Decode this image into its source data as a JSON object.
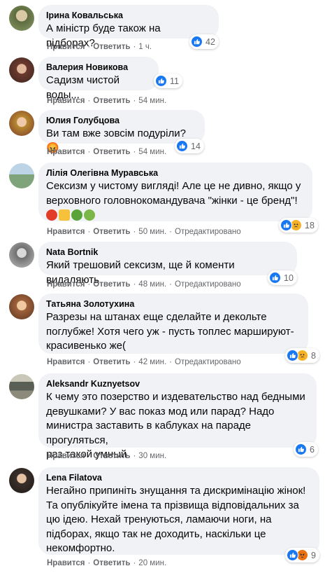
{
  "comments": [
    {
      "author": "Ірина Ковальська",
      "lines": [
        "А міністр буде також на підборах?"
      ],
      "like_label": "Нравится",
      "reply_label": "Ответить",
      "time": "1 ч.",
      "reaction_count": "42",
      "reactions": [
        "like"
      ],
      "avatar_color": "#8a9a66"
    },
    {
      "author": "Валерия Новикова",
      "lines": [
        "Садизм чистой воды..."
      ],
      "like_label": "Нравится",
      "reply_label": "Ответить",
      "time": "54 мин.",
      "reaction_count": "11",
      "reactions": [
        "like"
      ],
      "avatar_color": "#6b3a2e"
    },
    {
      "author": "Юлия Голубцова",
      "lines": [
        "Ви там вже зовсім подуріли?😡"
      ],
      "like_label": "Нравится",
      "reply_label": "Ответить",
      "time": "54 мин.",
      "reaction_count": "14",
      "reactions": [
        "like"
      ],
      "avatar_color": "#b8892e"
    },
    {
      "author": "Лілія Олегівна Муравська",
      "lines": [
        "Сексизм у чистому вигляді! Але це не дивно, якщо у",
        "верховного головнокомандувача \"жінки - це бренд\"!"
      ],
      "emojis": [
        "angry",
        "thumbs-down",
        "frog",
        "nauseated"
      ],
      "like_label": "Нравится",
      "reply_label": "Ответить",
      "time": "50 мин.",
      "edited": "Отредактировано",
      "reaction_count": "18",
      "reactions": [
        "like",
        "sad"
      ],
      "avatar_color": "#7fa37a"
    },
    {
      "author": "Nata Bortnik",
      "lines": [
        "Який трешовий сексизм, ще й коменти видаляють"
      ],
      "like_label": "Нравится",
      "reply_label": "Ответить",
      "time": "48 мин.",
      "edited": "Отредактировано",
      "reaction_count": "10",
      "reactions": [
        "like"
      ],
      "avatar_color": "#9a9a9a"
    },
    {
      "author": "Татьяна Золотухина",
      "lines": [
        "Разрезы на штанах еще сделайте и декольте",
        "поглубже! Хотя чего уж - пусть топлес маршируют-",
        "красивенько же("
      ],
      "like_label": "Нравится",
      "reply_label": "Ответить",
      "time": "42 мин.",
      "edited": "Отредактировано",
      "reaction_count": "8",
      "reactions": [
        "like",
        "sad"
      ],
      "avatar_color": "#a0623c"
    },
    {
      "author": "Aleksandr Kuznyetsov",
      "lines": [
        "К чему это позерство и издевательство над бедными",
        "девушками? У вас показ мод или парад? Надо",
        "министра заставить в каблуках на параде прогуляться,",
        "раз такой умный"
      ],
      "like_label": "Нравится",
      "reply_label": "Ответить",
      "time": "30 мин.",
      "reaction_count": "6",
      "reactions": [
        "like"
      ],
      "avatar_color": "#5a5f55"
    },
    {
      "author": "Lena Filatova",
      "lines": [
        "Негайно припиніть знущання та дискримінацію жінок!",
        "Та опублікуйте імена та прізвища відповідальних за",
        "цю ідею. Нехай тренуються, ламаючи ноги, на",
        "підборах, якщо так не доходить, наскільки це",
        "некомфортно."
      ],
      "like_label": "Нравится",
      "reply_label": "Ответить",
      "time": "20 мин.",
      "reaction_count": "9",
      "reactions": [
        "like",
        "angry"
      ],
      "avatar_color": "#3a2f2a"
    }
  ],
  "colors": {
    "bubble": "#f0f2f5",
    "meta_text": "#65676b",
    "like_blue": "#1877f2",
    "sad_yellow": "#f7b125",
    "angry_orange": "#e9710f"
  }
}
